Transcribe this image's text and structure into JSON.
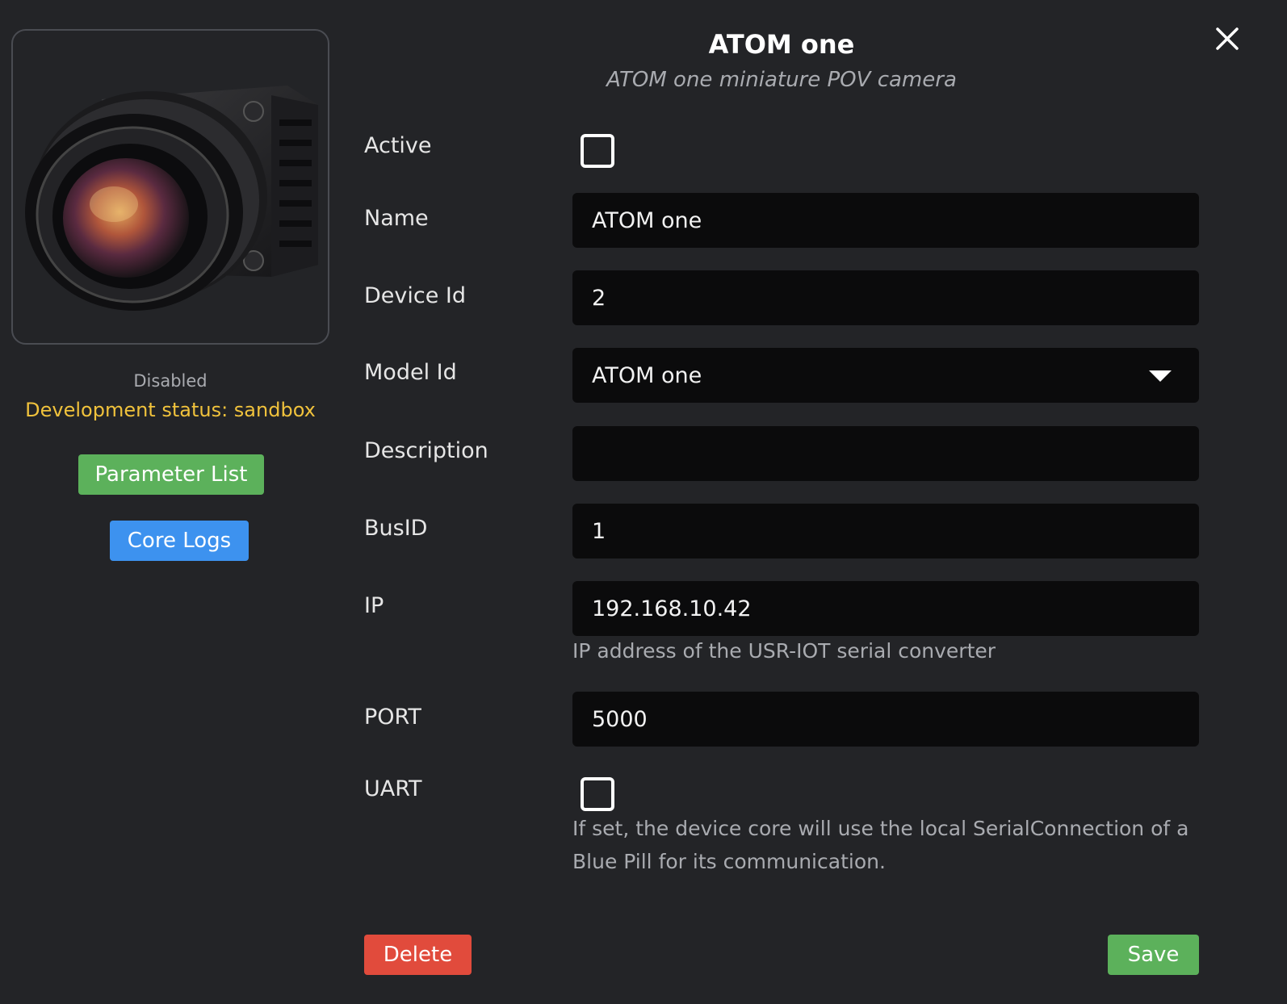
{
  "device": {
    "title": "ATOM one",
    "subtitle": "ATOM one miniature POV camera",
    "image_icon": "camera-image"
  },
  "status": {
    "state": "Disabled",
    "development": "Development status: sandbox"
  },
  "actions": {
    "parameter_list": "Parameter List",
    "core_logs": "Core Logs",
    "delete": "Delete",
    "save": "Save",
    "close_icon": "close-icon"
  },
  "form": {
    "active": {
      "label": "Active",
      "checked": false
    },
    "name": {
      "label": "Name",
      "value": "ATOM one"
    },
    "device_id": {
      "label": "Device Id",
      "value": "2"
    },
    "model_id": {
      "label": "Model Id",
      "value": "ATOM one"
    },
    "description": {
      "label": "Description",
      "value": ""
    },
    "bus_id": {
      "label": "BusID",
      "value": "1"
    },
    "ip": {
      "label": "IP",
      "value": "192.168.10.42",
      "help": "IP address of the USR-IOT serial converter"
    },
    "port": {
      "label": "PORT",
      "value": "5000"
    },
    "uart": {
      "label": "UART",
      "checked": false,
      "help": "If set, the device core will use the local SerialConnection of a Blue Pill for its communication."
    }
  },
  "colors": {
    "background": "#232427",
    "field": "#0b0b0c",
    "warning": "#f0c23c",
    "green": "#5cb15b",
    "blue": "#3d92ef",
    "red": "#e14b3c"
  }
}
